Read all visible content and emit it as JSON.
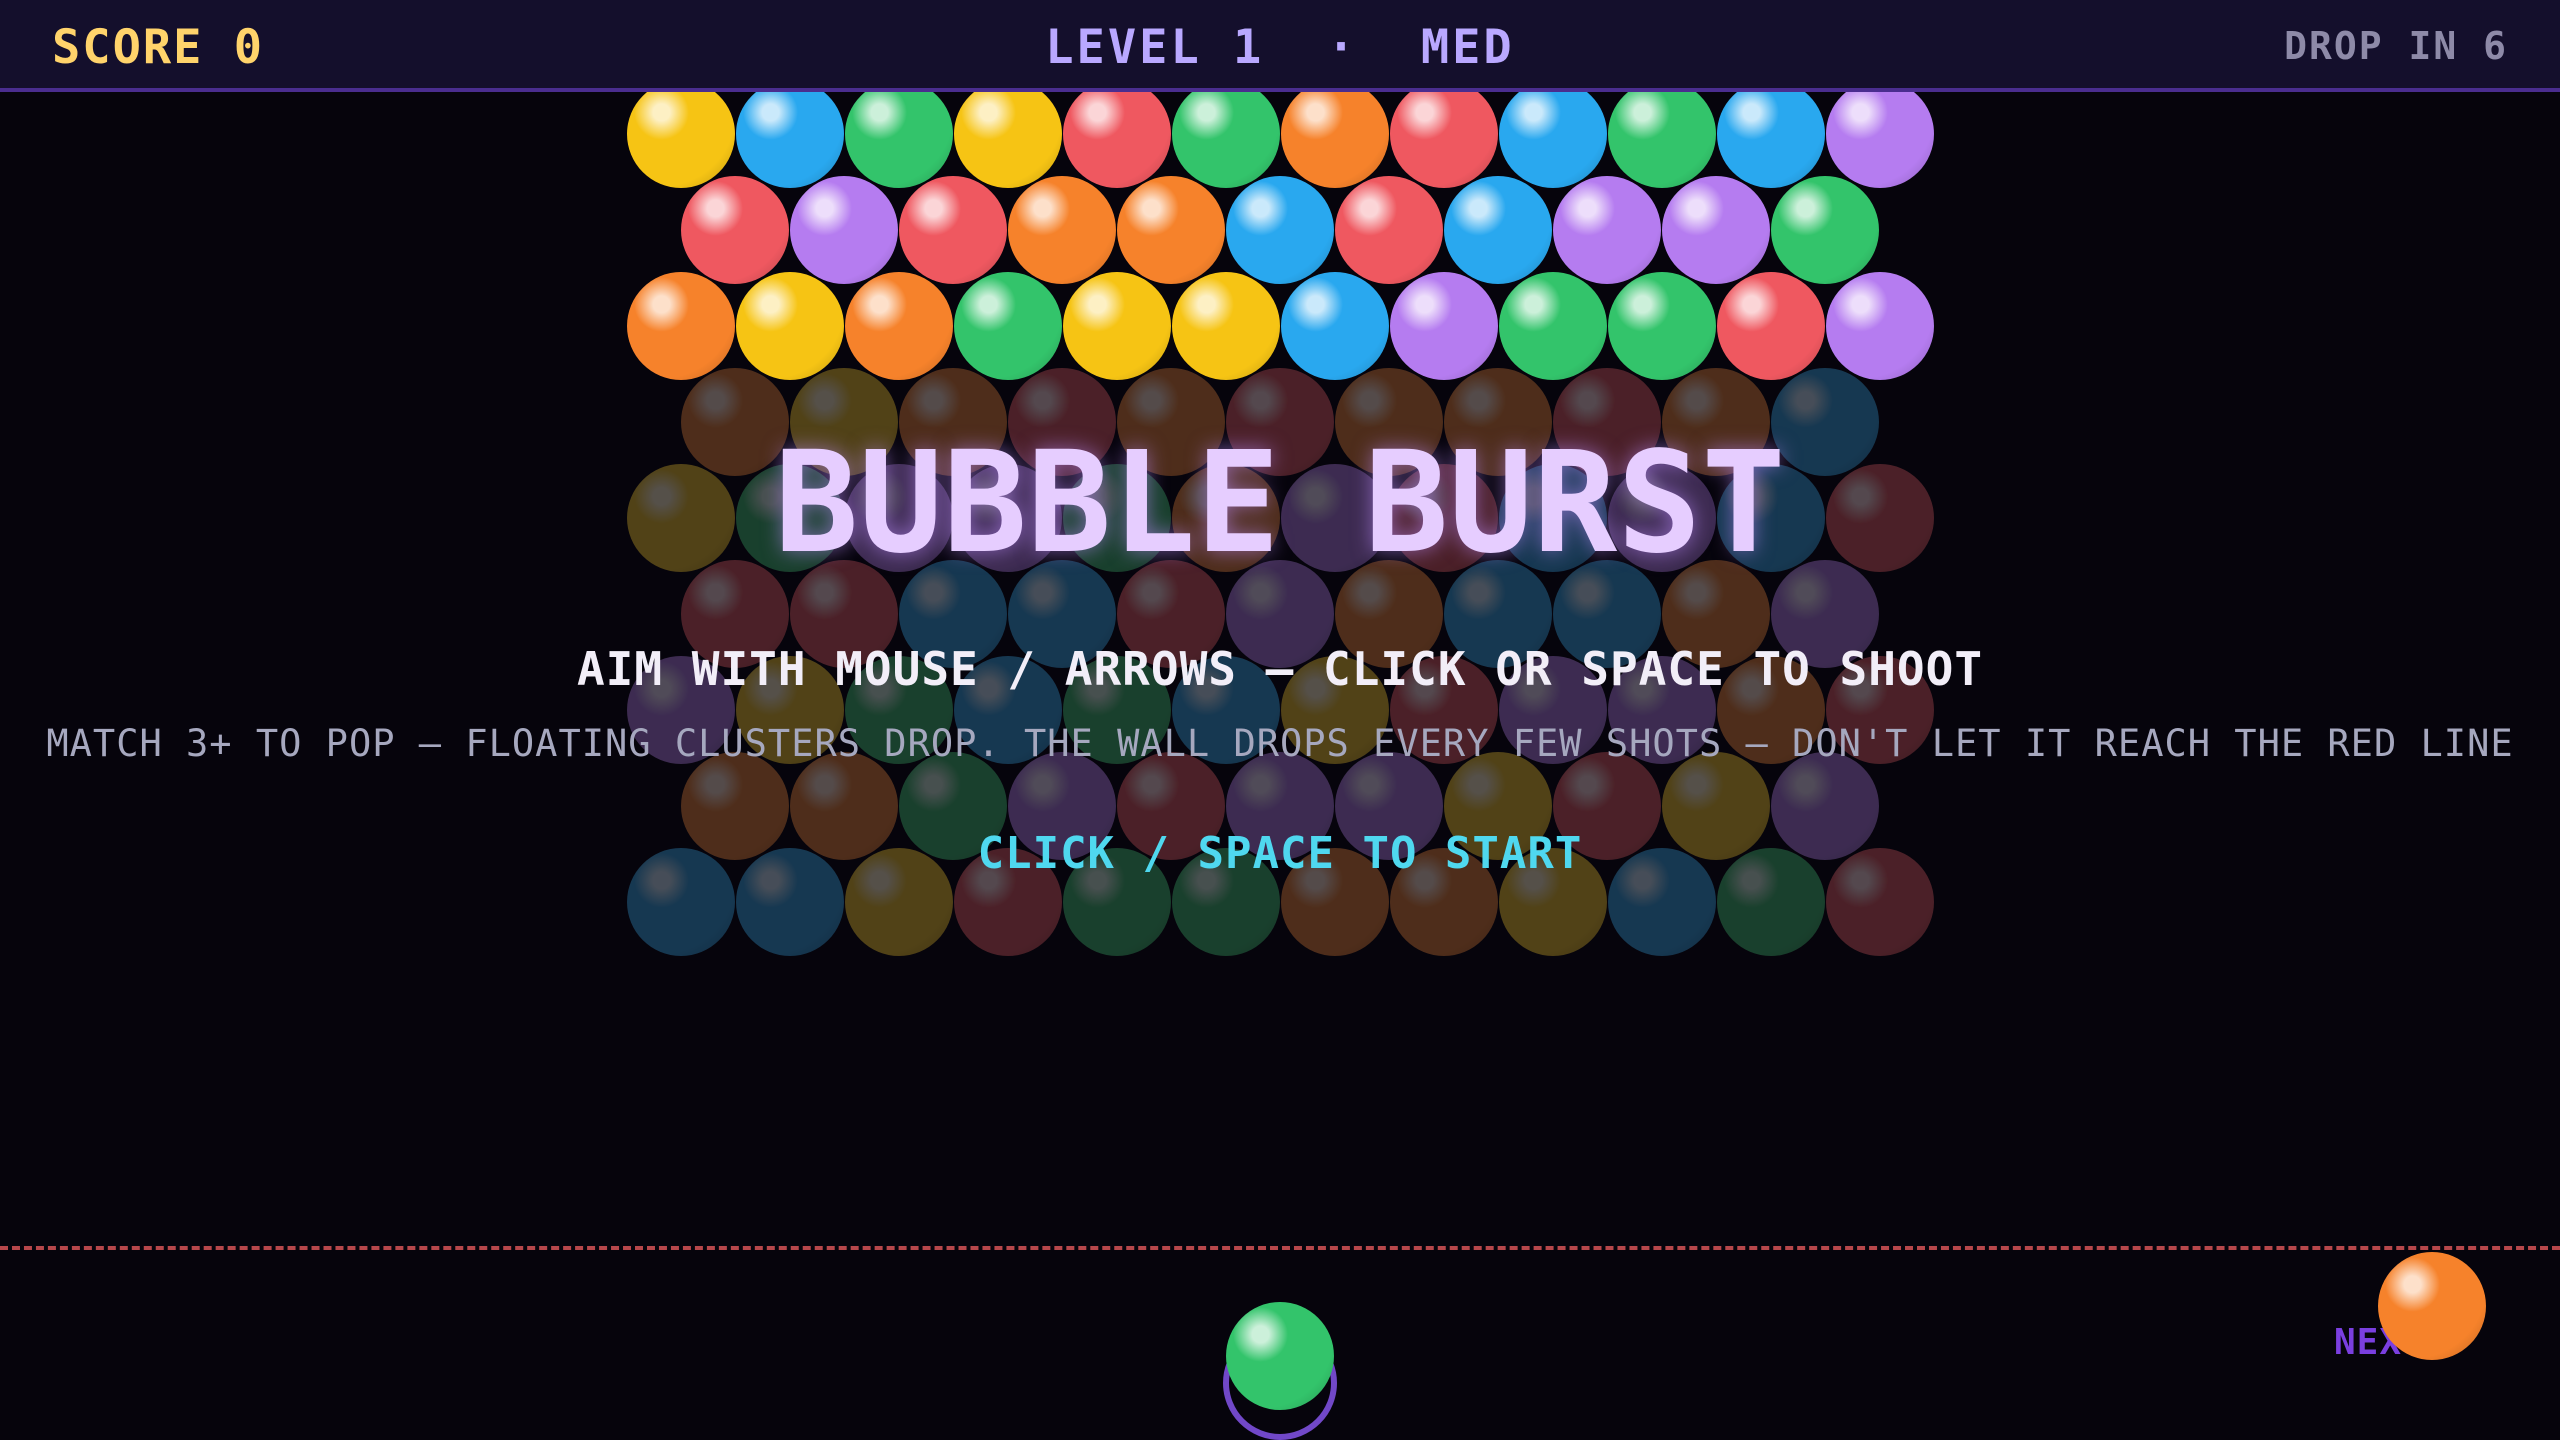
{
  "hud": {
    "score_text": "SCORE 0",
    "level_text": "LEVEL 1  ·  MED",
    "drop_text": "DROP IN 6"
  },
  "overlay": {
    "title": "BUBBLE BURST",
    "instruction_1": "AIM WITH MOUSE / ARROWS — CLICK OR SPACE TO SHOOT",
    "instruction_2": "MATCH 3+ TO POP — FLOATING CLUSTERS DROP. THE WALL DROPS EVERY FEW SHOTS — DON'T LET IT REACH THE RED LINE",
    "start_prompt": "CLICK / SPACE TO START"
  },
  "palette": {
    "Y": "#f6c414",
    "B": "#29a8ef",
    "G": "#33c46b",
    "R": "#ef5860",
    "O": "#f6822b",
    "P": "#b57cf0"
  },
  "grid": {
    "rows": [
      "YBGYRGORBGBP",
      "RPROOBRBPPG",
      "OYOGYYBPGGRP",
      "OYOROROOROB",
      "YGPPGOPRBPBR",
      "RRBBRPOBBOP",
      "PYGBGBYRPPOR",
      "OOGPRPPYRYP",
      "BBYRGGOOYBGR"
    ],
    "bright_rows": 3
  },
  "launcher": {
    "current_color": "G",
    "next_color": "O",
    "next_label": "NEXT"
  }
}
